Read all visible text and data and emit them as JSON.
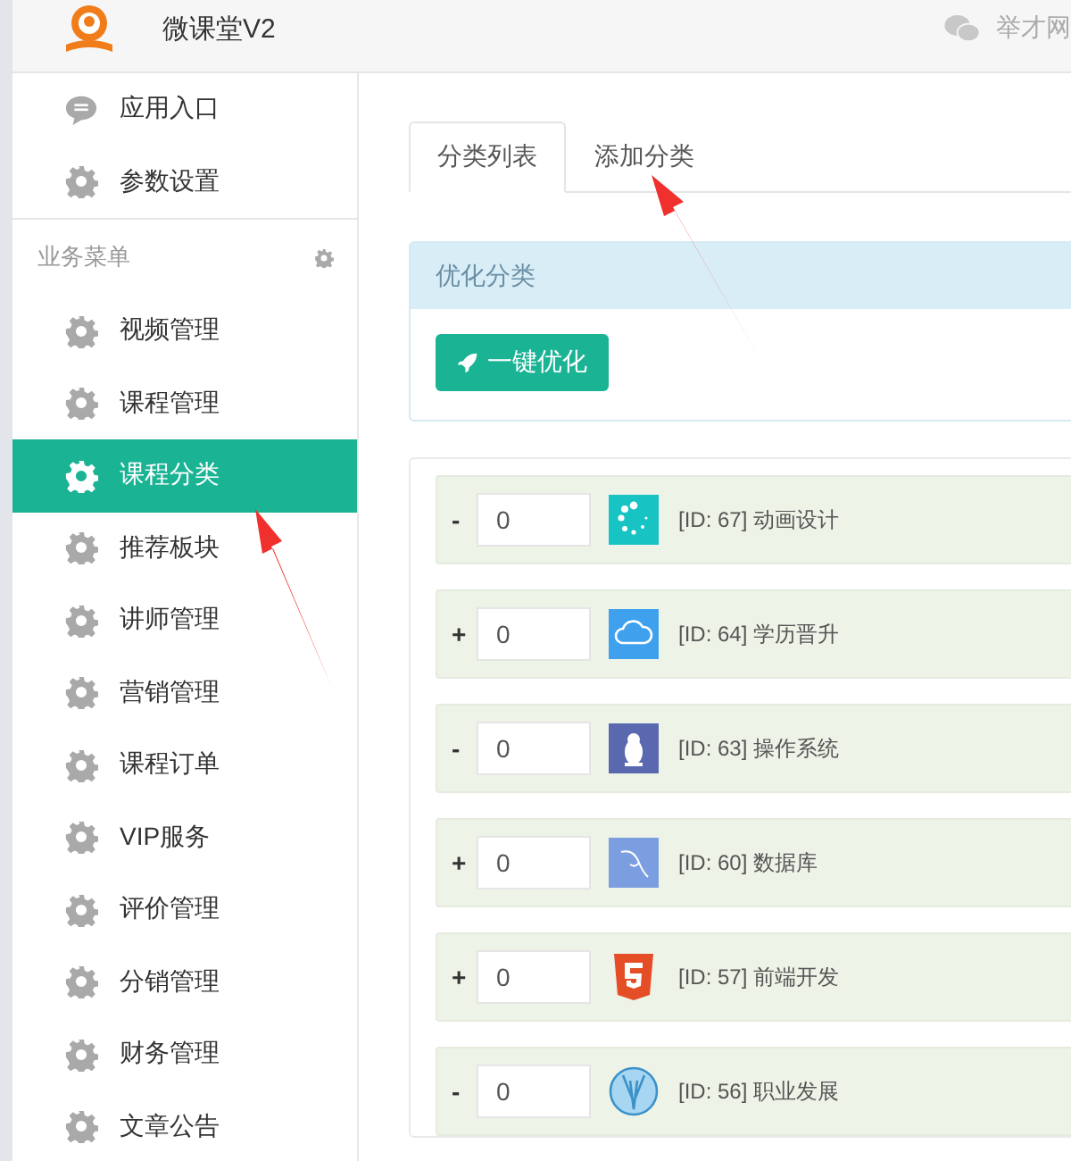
{
  "header": {
    "title": "微课堂V2",
    "account": "举才网"
  },
  "sidebar": {
    "top_items": [
      {
        "label": "应用入口",
        "selected": false
      },
      {
        "label": "参数设置",
        "selected": false
      }
    ],
    "section": "业务菜单",
    "items": [
      {
        "label": "视频管理",
        "selected": false
      },
      {
        "label": "课程管理",
        "selected": false
      },
      {
        "label": "课程分类",
        "selected": true
      },
      {
        "label": "推荐板块",
        "selected": false
      },
      {
        "label": "讲师管理",
        "selected": false
      },
      {
        "label": "营销管理",
        "selected": false
      },
      {
        "label": "课程订单",
        "selected": false
      },
      {
        "label": "VIP服务",
        "selected": false
      },
      {
        "label": "评价管理",
        "selected": false
      },
      {
        "label": "分销管理",
        "selected": false
      },
      {
        "label": "财务管理",
        "selected": false
      },
      {
        "label": "文章公告",
        "selected": false
      }
    ]
  },
  "tabs": [
    {
      "label": "分类列表",
      "selected": true
    },
    {
      "label": "添加分类",
      "selected": false
    }
  ],
  "optimize_panel": {
    "title": "优化分类",
    "button": "一键优化"
  },
  "categories": [
    {
      "toggle": "-",
      "order": "0",
      "kind": "spinner",
      "label": "[ID: 67] 动画设计"
    },
    {
      "toggle": "+",
      "order": "0",
      "kind": "cloud",
      "label": "[ID: 64] 学历晋升"
    },
    {
      "toggle": "-",
      "order": "0",
      "kind": "penguin",
      "label": "[ID: 63] 操作系统"
    },
    {
      "toggle": "+",
      "order": "0",
      "kind": "dolphin",
      "label": "[ID: 60] 数据库"
    },
    {
      "toggle": "+",
      "order": "0",
      "kind": "html5",
      "label": "[ID: 57] 前端开发"
    },
    {
      "toggle": "-",
      "order": "0",
      "kind": "tie",
      "label": "[ID: 56] 职业发展"
    }
  ]
}
